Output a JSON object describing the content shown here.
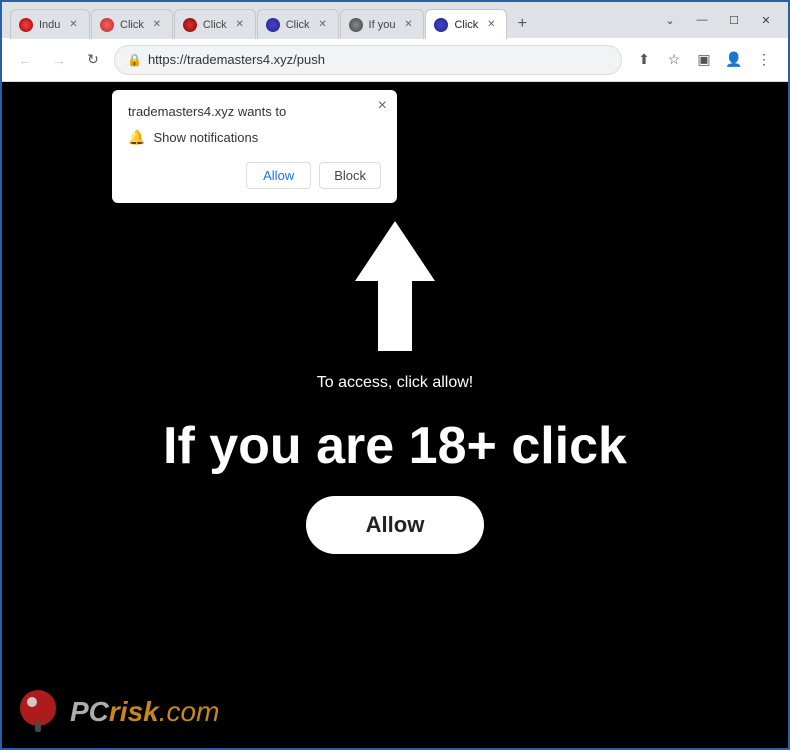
{
  "browser": {
    "window_controls": {
      "chevron_down": "⌄",
      "minimize": "—",
      "maximize": "☐",
      "close": "✕"
    },
    "tabs": [
      {
        "id": "tab1",
        "label": "Indu",
        "active": false,
        "fav_class": "fav-indu"
      },
      {
        "id": "tab2",
        "label": "Click",
        "active": false,
        "fav_class": "fav-click1"
      },
      {
        "id": "tab3",
        "label": "Click",
        "active": false,
        "fav_class": "fav-click2"
      },
      {
        "id": "tab4",
        "label": "Click",
        "active": false,
        "fav_class": "fav-click3"
      },
      {
        "id": "tab5",
        "label": "If you",
        "active": false,
        "fav_class": "fav-ifyou"
      },
      {
        "id": "tab6",
        "label": "Click",
        "active": true,
        "fav_class": "fav-click4"
      }
    ],
    "new_tab_icon": "+",
    "address_bar": {
      "url": "https://trademasters4.xyz/push",
      "lock_icon": "🔒"
    },
    "nav": {
      "back": "←",
      "forward": "→",
      "reload": "↻"
    },
    "toolbar": {
      "share": "⬆",
      "bookmark": "☆",
      "tablet": "▣",
      "profile": "👤",
      "menu": "⋮"
    }
  },
  "notification_popup": {
    "title": "trademasters4.xyz wants to",
    "close_icon": "×",
    "bell_icon": "🔔",
    "permission_text": "Show notifications",
    "allow_label": "Allow",
    "block_label": "Block"
  },
  "page": {
    "arrow_label": "To access, click allow!",
    "big_text": "If you are 18+ click",
    "allow_button_label": "Allow"
  },
  "watermark": {
    "pc_text": "PC",
    "risk_text": "risk",
    "domain_text": ".com"
  }
}
